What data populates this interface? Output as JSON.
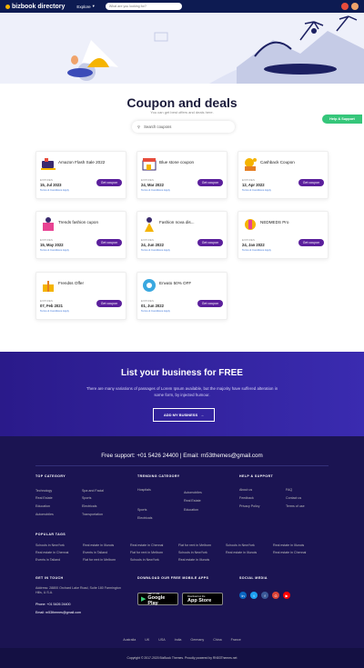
{
  "nav": {
    "logo_text": "bizbook directory",
    "explore_label": "Explore",
    "search_placeholder": "What are you looking for?"
  },
  "page": {
    "title": "Coupon and deals",
    "subtitle": "You can get best offers and deals here.",
    "search_placeholder": "Search coupons",
    "help_label": "Help & Support"
  },
  "cards": [
    {
      "title": "Amazon Flash Sale 2022",
      "expiry_label": "EXPIRES",
      "date": "15, Jul 2023",
      "terms": "Terms & Conditions Apply",
      "button": "Get coupon"
    },
    {
      "title": "Blue stone coupon",
      "expiry_label": "EXPIRES",
      "date": "24, Mar 2022",
      "terms": "Terms & Conditions Apply",
      "button": "Get coupon"
    },
    {
      "title": "Cashback Coupon",
      "expiry_label": "EXPIRES",
      "date": "12, Apr 2022",
      "terms": "Terms & Conditions Apply",
      "button": "Get coupon"
    },
    {
      "title": "Trends fashion cupon",
      "expiry_label": "EXPIRES",
      "date": "15, May 2022",
      "terms": "Terms & Conditions Apply",
      "button": "Get coupon"
    },
    {
      "title": "Fashion nova dis...",
      "expiry_label": "EXPIRES",
      "date": "24, Jun 2022",
      "terms": "Terms & Conditions Apply",
      "button": "Get coupon"
    },
    {
      "title": "NEDMEDS Pro",
      "expiry_label": "EXPIRES",
      "date": "24, Jan 2022",
      "terms": "Terms & Conditions Apply",
      "button": "Get coupon"
    },
    {
      "title": "Frendss Offer",
      "expiry_label": "EXPIRES",
      "date": "07, Feb 2021",
      "terms": "Terms & Conditions Apply",
      "button": "Get coupon"
    },
    {
      "title": "Envato 50% OFF",
      "expiry_label": "EXPIRES",
      "date": "01, Jun 2022",
      "terms": "Terms & Conditions Apply",
      "button": "Get coupon"
    }
  ],
  "cta": {
    "title": "List your business for FREE",
    "text": "There are many variations of passages of Lorem Ipsum available, but the majority have suffered alteration in some form, by injected humour.",
    "button": "ADD MY BUSINESS"
  },
  "footer": {
    "support": "Free support: +01 5426 24400 | Email: rn53themes@gmail.com",
    "top_category_title": "TOP CATEGORY",
    "top_category": [
      "Technology",
      "Spa and Facial",
      "Real Estate",
      "Sports",
      "Education",
      "Electricals",
      "Automobiles",
      "Transportation"
    ],
    "trending_title": "TRENDING CATEGORY",
    "trending": [
      "Hospitals",
      "Automobiles",
      "Real Estate",
      "Sports",
      "Education",
      "Electricals"
    ],
    "help_title": "HELP & SUPPORT",
    "help": [
      "About us",
      "FAQ",
      "Feedback",
      "Contact us",
      "Privacy Policy",
      "Terms of use"
    ],
    "popular_title": "POPULAR TAGS",
    "tags": [
      "Schools in NewYork",
      "Real estate in Illunois",
      "Real estate in Chennai",
      "Flat for rent in Melborn",
      "Schools in NewYork",
      "Real estate in Illunois",
      "Real estate in Chennai",
      "Events in Tailand",
      "Flat for rent in Melborn",
      "Schools in NewYork",
      "Real estate in Illunois",
      "Real estate in Chennai",
      "Events in Tailand",
      "Flat for rent in Melborn",
      "Schools in NewYork",
      "Real estate in Illunois"
    ],
    "touch_title": "GET IN TOUCH",
    "address": "Address: 28800 Orchard Lake Road, Suite 180 Farmington Hills, U.S.A.",
    "phone": "Phone: +01 5426 24400",
    "email": "Email: rn53themes@gmail.com",
    "apps_title": "DOWNLOAD OUR FREE MOBILE APPS",
    "gp_small": "GET IT ON",
    "gp_big": "Google Play",
    "as_small": "Download on the",
    "as_big": "App Store",
    "social_title": "SOCIAL MEDIA",
    "countries": [
      "Australia",
      "UK",
      "USA",
      "India",
      "Germany",
      "China",
      "France"
    ],
    "copyright": "Copyright © 2017-2020 BizBook Themes. Proudly powered by RN53Themes.net"
  }
}
